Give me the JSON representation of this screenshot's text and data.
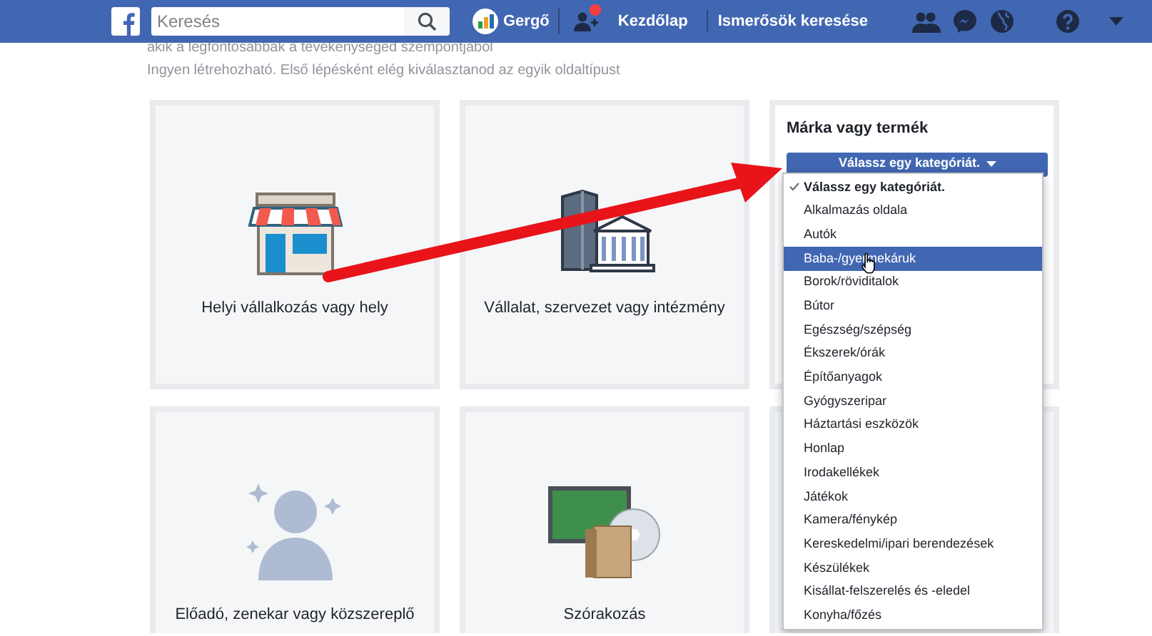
{
  "header": {
    "search": {
      "placeholder": "Keresés"
    },
    "profile": {
      "name": "Gergő"
    },
    "friend_requests": {
      "unread": true
    },
    "nav_links": [
      "Kezdőlap",
      "Ismerősök keresése"
    ]
  },
  "intro": [
    "akik a legfontosabbak a tevékenységed szempontjából",
    "Ingyen létrehozható. Első lépésként elég kiválasztanod az egyik oldaltípust"
  ],
  "card_rows": [
    {
      "cards": [
        {
          "kind": "store",
          "label": "Helyi vállalkozás vagy hely"
        },
        {
          "kind": "building",
          "label": "Vállalat, szervezet vagy intézmény"
        },
        {
          "kind": "brand",
          "title": "Márka vagy termék",
          "dropdown": {
            "label": "Válassz egy kategóriát.",
            "items": [
              {
                "label": "Válassz egy kategóriát.",
                "checked": true,
                "highlighted": false
              },
              {
                "label": "Alkalmazás oldala",
                "checked": false,
                "highlighted": false
              },
              {
                "label": "Autók",
                "checked": false,
                "highlighted": false
              },
              {
                "label": "Baba-/gyermekáruk",
                "checked": false,
                "highlighted": true
              },
              {
                "label": "Borok/röviditalok",
                "checked": false,
                "highlighted": false
              },
              {
                "label": "Bútor",
                "checked": false,
                "highlighted": false
              },
              {
                "label": "Egészség/szépség",
                "checked": false,
                "highlighted": false
              },
              {
                "label": "Ékszerek/órák",
                "checked": false,
                "highlighted": false
              },
              {
                "label": "Építőanyagok",
                "checked": false,
                "highlighted": false
              },
              {
                "label": "Gyógyszeripar",
                "checked": false,
                "highlighted": false
              },
              {
                "label": "Háztartási eszközök",
                "checked": false,
                "highlighted": false
              },
              {
                "label": "Honlap",
                "checked": false,
                "highlighted": false
              },
              {
                "label": "Irodakellékek",
                "checked": false,
                "highlighted": false
              },
              {
                "label": "Játékok",
                "checked": false,
                "highlighted": false
              },
              {
                "label": "Kamera/fénykép",
                "checked": false,
                "highlighted": false
              },
              {
                "label": "Kereskedelmi/ipari berendezések",
                "checked": false,
                "highlighted": false
              },
              {
                "label": "Készülékek",
                "checked": false,
                "highlighted": false
              },
              {
                "label": "Kisállat-felszerelés és -eledel",
                "checked": false,
                "highlighted": false
              },
              {
                "label": "Konyha/főzés",
                "checked": false,
                "highlighted": false
              }
            ]
          }
        }
      ]
    },
    {
      "cards": [
        {
          "kind": "artist",
          "label": "Előadó, zenekar vagy közszereplő"
        },
        {
          "kind": "entertainment",
          "label": "Szórakozás"
        },
        {
          "kind": "blank"
        }
      ]
    }
  ]
}
